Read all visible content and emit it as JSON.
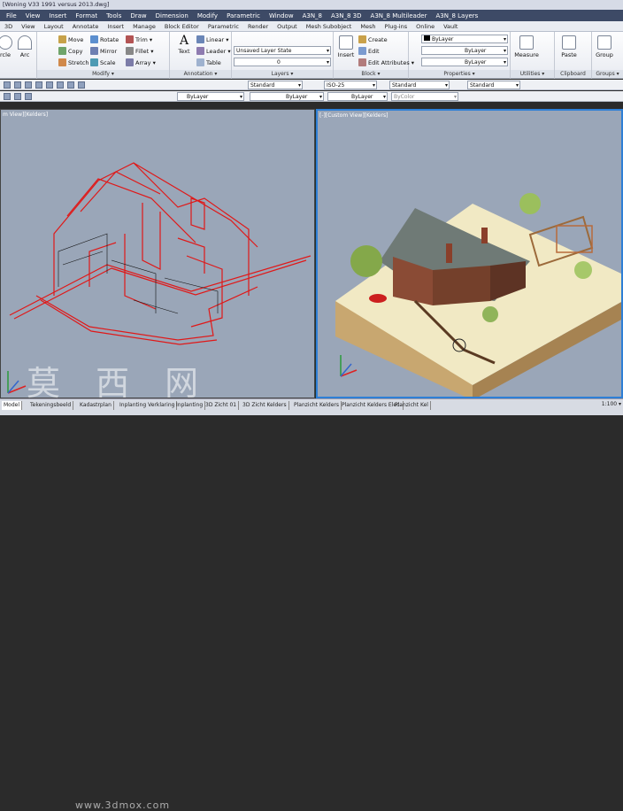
{
  "title": "[Woning V33 1991 versus 2013.dwg]",
  "menu": [
    "File",
    "View",
    "Insert",
    "Format",
    "Tools",
    "Draw",
    "Dimension",
    "Modify",
    "Parametric",
    "Window",
    "A3N_8",
    "A3N_8 3D",
    "A3N_8 Multileader",
    "A3N_8 Layers"
  ],
  "tabs": [
    "3D",
    "View",
    "Layout",
    "Annotate",
    "Insert",
    "Manage",
    "Block Editor",
    "Parametric",
    "Render",
    "Output",
    "Mesh Subobject",
    "Mesh",
    "Plug-ins",
    "Online",
    "Vault"
  ],
  "ribbon": {
    "draw": {
      "circle": "rcle",
      "arc": "Arc"
    },
    "modify": {
      "label": "Modify ▾",
      "move": "Move",
      "rotate": "Rotate",
      "trim": "Trim ▾",
      "copy": "Copy",
      "mirror": "Mirror",
      "fillet": "Fillet ▾",
      "stretch": "Stretch",
      "scale": "Scale",
      "array": "Array ▾"
    },
    "annotation": {
      "label": "Annotation ▾",
      "text": "Text",
      "linear": "Linear ▾",
      "leader": "Leader ▾",
      "table": "Table"
    },
    "layers": {
      "label": "Layers ▾",
      "state": "Unsaved Layer State",
      "layer": "0"
    },
    "block": {
      "label": "Block ▾",
      "insert": "Insert",
      "create": "Create",
      "edit": "Edit",
      "editattr": "Edit Attributes ▾"
    },
    "properties": {
      "label": "Properties ▾",
      "color": "ByLayer",
      "lineweight": "ByLayer",
      "linetype": "ByLayer"
    },
    "utilities": {
      "label": "Utilities ▾",
      "measure": "Measure"
    },
    "clipboard": {
      "label": "Clipboard",
      "paste": "Paste"
    },
    "groups": {
      "label": "Groups ▾",
      "group": "Group"
    }
  },
  "toolbar1": {
    "textstyle": "Standard",
    "dimstyle": "ISO-25",
    "tablestyle": "Standard",
    "mleaderstyle": "Standard"
  },
  "toolbar2": {
    "color": "ByLayer",
    "linetype": "ByLayer",
    "lineweight": "ByLayer",
    "plotstyle": "ByColor"
  },
  "viewports": {
    "left_label": "m View][Kelders]",
    "right_label": "[-][Custom View][Kelders]"
  },
  "layout_tabs": [
    "Model",
    "Tekeningsbeeld",
    "Kadastrplan",
    "Inplanting Verklaring",
    "Inplanting",
    "3D Zicht 01",
    "3D Zicht Kelders",
    "Planzicht Kelders",
    "Planzicht Kelders Elec.",
    "Planzicht Kel"
  ],
  "status": {
    "coords": "1:100 ▾"
  },
  "watermark": "莫 西 网",
  "watermark_url": "www.3dmox.com",
  "colors": {
    "menubar": "#3d4a66",
    "viewport_bg": "#9aa6b8",
    "active_border": "#2e7fd6",
    "wire_red": "#e01818"
  }
}
